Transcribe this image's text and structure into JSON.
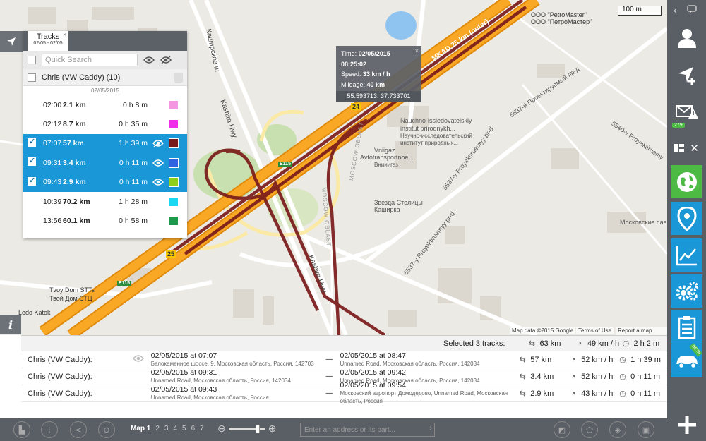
{
  "map": {
    "scale_label": "100 m",
    "footer": {
      "data": "Map data ©2015 Google",
      "terms": "Terms of Use",
      "report": "Report a map error"
    },
    "labels": {
      "kashirskoe": "Каширское ш",
      "kashira_hwy": "Kashira Hwy",
      "kashira_hwy2": "Kashira Hwy",
      "mkad": "MKAD 25 km (outer)",
      "petromaster1": "OOO \"PetroMaster\"",
      "petromaster2": "ООО \"ПетроМастер\"",
      "nauchno1": "Nauchno-issledovatelskiy",
      "nauchno2": "institut prirodnykh...",
      "nauchno3": "Научно-исследовательский",
      "nauchno4": "институт природных...",
      "vniigaz1": "Vniigaz",
      "vniigaz2": "Avtotransportnoe...",
      "vniigaz3": "Внииигаз",
      "zvezda1": "Звезда Столицы",
      "zvezda2": "Каширка",
      "moscow_oblast": "MOSCOW OBLAST",
      "moscow_oblast2": "MOSCOW OBLAST",
      "proyekt1": "5537-y Proyektiruemyy pr-d",
      "proyekt2": "5537-й Проектируемый пр-д",
      "proyekt3": "5540-y Proyektiruemy",
      "moskovskoe": "Московские пави...",
      "tvoy1": "Tvoy Dom STTs",
      "tvoy2": "Твой Дом СТЦ",
      "ledo": "Ledo Katok",
      "s24": "24",
      "s25": "25",
      "e115a": "E115",
      "e115b": "E115"
    }
  },
  "tooltip": {
    "time_label": "Time:",
    "time_value": "02/05/2015 08:25:02",
    "speed_label": "Speed:",
    "speed_value": "33 km / h",
    "mileage_label": "Mileage:",
    "mileage_value": "40 km",
    "coords": "55.593713, 37.733701",
    "close": "×"
  },
  "tracks_panel": {
    "tab_title": "Tracks",
    "tab_dates": "02/05 - 02/05",
    "close": "×",
    "search_placeholder": "Quick Search",
    "group_label": "Chris (VW Caddy) (10)",
    "date_separator": "02/05/2015",
    "rows": [
      {
        "time": "02:00",
        "km": "2.1 km",
        "dur": "0 h 8 m",
        "color": "#f497e0",
        "selected": false
      },
      {
        "time": "02:12",
        "km": "8.7 km",
        "dur": "0 h 35 m",
        "color": "#ee2ee8",
        "selected": false
      },
      {
        "time": "07:07",
        "km": "57 km",
        "dur": "1 h 39 m",
        "color": "#7a1b1b",
        "selected": true
      },
      {
        "time": "09:31",
        "km": "3.4 km",
        "dur": "0 h 11 m",
        "color": "#2f63df",
        "selected": true
      },
      {
        "time": "09:43",
        "km": "2.9 km",
        "dur": "0 h 11 m",
        "color": "#8fd11a",
        "selected": true
      },
      {
        "time": "10:39",
        "km": "70.2 km",
        "dur": "1 h 28 m",
        "color": "#1ad8f2",
        "selected": false
      },
      {
        "time": "13:56",
        "km": "60.1 km",
        "dur": "0 h 58 m",
        "color": "#1e9a4c",
        "selected": false
      }
    ]
  },
  "results": {
    "summary_label": "Selected 3 tracks:",
    "summary": {
      "distance": "63 km",
      "speed": "49 km / h",
      "duration": "2 h 2 m"
    },
    "rows": [
      {
        "name": "Chris (VW Caddy):",
        "start": "02/05/2015 at 07:07",
        "start_addr": "Белокаменное шоссе, 9, Московская область, Россия, 142703",
        "end": "02/05/2015 at 08:47",
        "end_addr": "Unnamed Road, Московская область, Россия, 142034",
        "km": "57 km",
        "speed": "52 km / h",
        "dur": "1 h 39 m"
      },
      {
        "name": "Chris (VW Caddy):",
        "start": "02/05/2015 at 09:31",
        "start_addr": "Unnamed Road, Московская область, Россия, 142034",
        "end": "02/05/2015 at 09:42",
        "end_addr": "Unnamed Road, Московская область, Россия, 142034",
        "km": "3.4 km",
        "speed": "52 km / h",
        "dur": "0 h 11 m"
      },
      {
        "name": "Chris (VW Caddy):",
        "start": "02/05/2015 at 09:43",
        "start_addr": "Unnamed Road, Московская область, Россия",
        "end": "02/05/2015 at 09:54",
        "end_addr": "Московский аэропорт Домодедово, Unnamed Road, Московская область, Россия",
        "km": "2.9 km",
        "speed": "43 km / h",
        "dur": "0 h 11 m"
      }
    ],
    "dash": "—"
  },
  "toolbar": {
    "map_current": "Map 1",
    "maps": [
      "2",
      "3",
      "4",
      "5",
      "6",
      "7"
    ],
    "address_placeholder": "Enter an address or its part...",
    "arrow": "›"
  },
  "sidebar": {
    "messages_badge": "279",
    "beta": "BETA"
  },
  "colors": {
    "accent": "#1a97d7",
    "green": "#4dbb43",
    "track": "#7a1b1b",
    "road": "#f39c12",
    "panel": "#5a5f66"
  }
}
